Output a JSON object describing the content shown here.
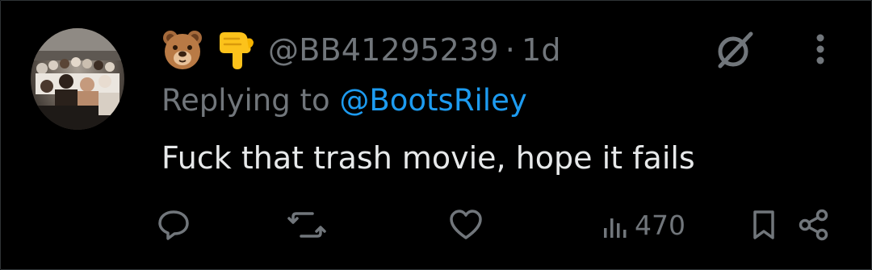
{
  "tweet": {
    "header": {
      "emojis": [
        "bear-face",
        "backhand-index-pointing-down"
      ],
      "handle": "@BB41295239",
      "separator": "·",
      "time": "1d"
    },
    "replying": {
      "prefix": "Replying to",
      "mention": "@BootsRiley"
    },
    "text": "Fuck that trash movie, hope it fails",
    "actions": {
      "reply_icon": "comment-icon",
      "repost_icon": "retweet-icon",
      "like_icon": "heart-icon",
      "views_icon": "bar-chart-icon",
      "views": "470",
      "bookmark_icon": "bookmark-icon",
      "share_icon": "share-icon"
    },
    "top_right_icons": [
      "grok-icon",
      "more-vertical-icon"
    ]
  },
  "colors": {
    "background": "#000000",
    "text": "#e7e9ea",
    "muted": "#71767b",
    "accent": "#1d9bf0"
  }
}
